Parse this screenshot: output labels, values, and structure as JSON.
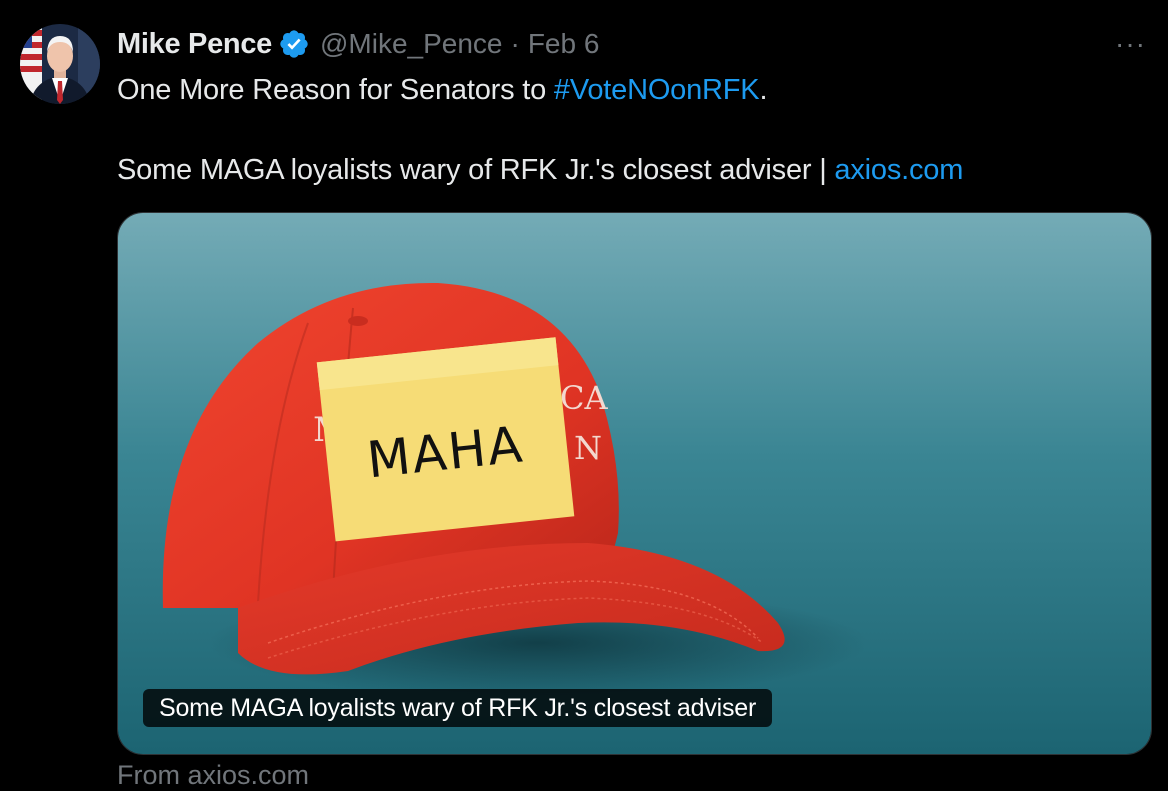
{
  "author": {
    "display_name": "Mike Pence",
    "handle": "@Mike_Pence",
    "separator": "·",
    "date": "Feb 6",
    "verified_icon": "verified-badge-icon",
    "avatar_icon": "profile-photo"
  },
  "more_menu": {
    "icon": "more-horizontal-icon",
    "label": "···"
  },
  "tweet": {
    "line1_text": "One More Reason for Senators to ",
    "hashtag": "#VoteNOonRFK",
    "line1_end": ".",
    "line2_text": "Some MAGA loyalists wary of RFK Jr.'s closest adviser | ",
    "link_text": "axios.com"
  },
  "card": {
    "title": "Some MAGA loyalists wary of RFK Jr.'s closest adviser",
    "image_note_text": "MAHA",
    "hat_text_left": "M",
    "hat_text_right_top": "CA",
    "hat_text_right_bottom": "N",
    "from_domain": "From axios.com"
  },
  "colors": {
    "background": "#000000",
    "text_primary": "#e7e9ea",
    "text_secondary": "#71767b",
    "link": "#1d9bf0",
    "card_bg_top": "#6fa9b5",
    "card_bg_bottom": "#1f6b78",
    "hat_red": "#e8352a",
    "note_yellow": "#f9e27a"
  }
}
